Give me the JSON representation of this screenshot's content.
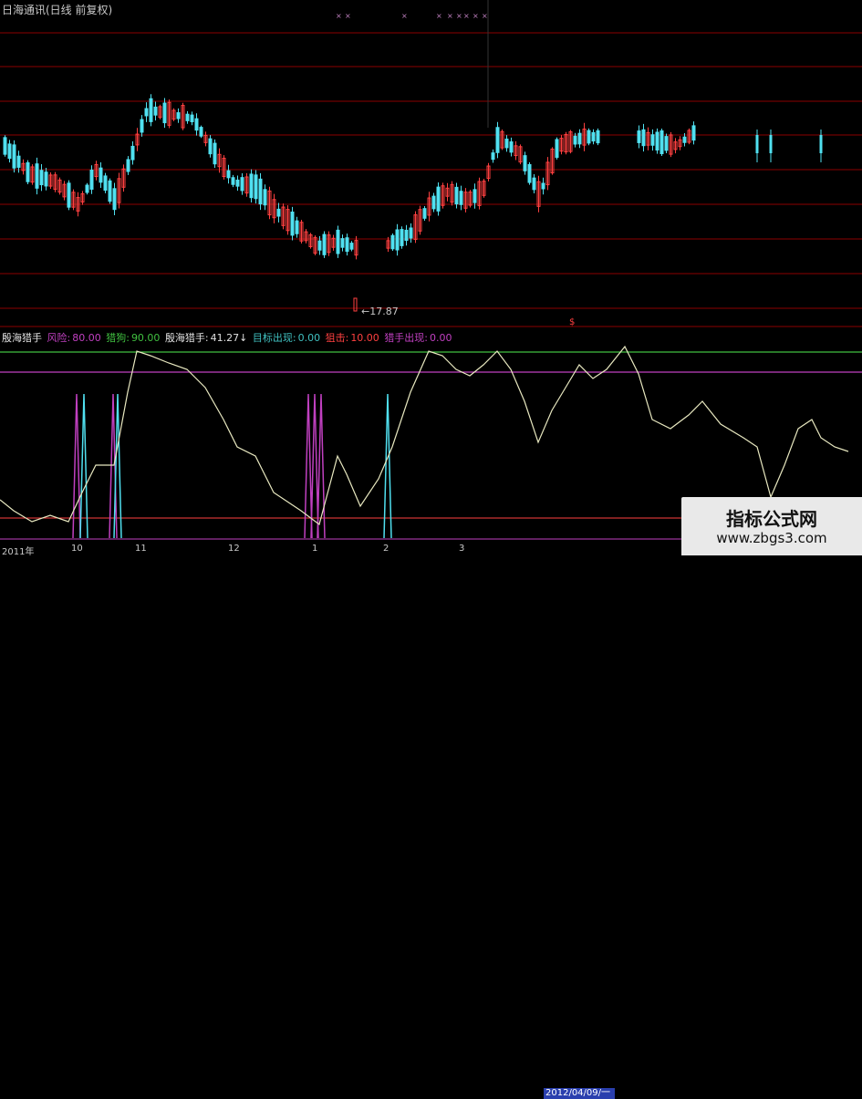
{
  "window": {
    "title": "日海通讯(日线 前复权)"
  },
  "price_panel": {
    "low_label": "←17.87",
    "marker_label": "$",
    "marker_color": "#ff4040"
  },
  "indicator_header": {
    "name": "殷海猎手",
    "items": [
      {
        "label": "风险:",
        "value": "80.00",
        "color": "#c040c0"
      },
      {
        "label": "猎狗:",
        "value": "90.00",
        "color": "#40c040"
      },
      {
        "label": "殷海猎手:",
        "value": "41.27↓",
        "color": "#e0e0e0"
      },
      {
        "label": "目标出现:",
        "value": "0.00",
        "color": "#40c0c0"
      },
      {
        "label": "狙击:",
        "value": "10.00",
        "color": "#ff4040"
      },
      {
        "label": "猎手出现:",
        "value": "0.00",
        "color": "#c040c0"
      }
    ]
  },
  "x_axis": {
    "ticks": [
      "2011年",
      "10",
      "11",
      "12",
      "1",
      "2",
      "3"
    ],
    "highlight": "2012/04/09/一"
  },
  "watermark": {
    "title": "指标公式网",
    "url": "www.zbgs3.com"
  },
  "colors": {
    "up": "#ff4040",
    "down": "#50e0f0",
    "grid": "#8b0000",
    "line": "#e8e8c0",
    "risk": "#c040c0",
    "dog": "#40c040"
  }
}
